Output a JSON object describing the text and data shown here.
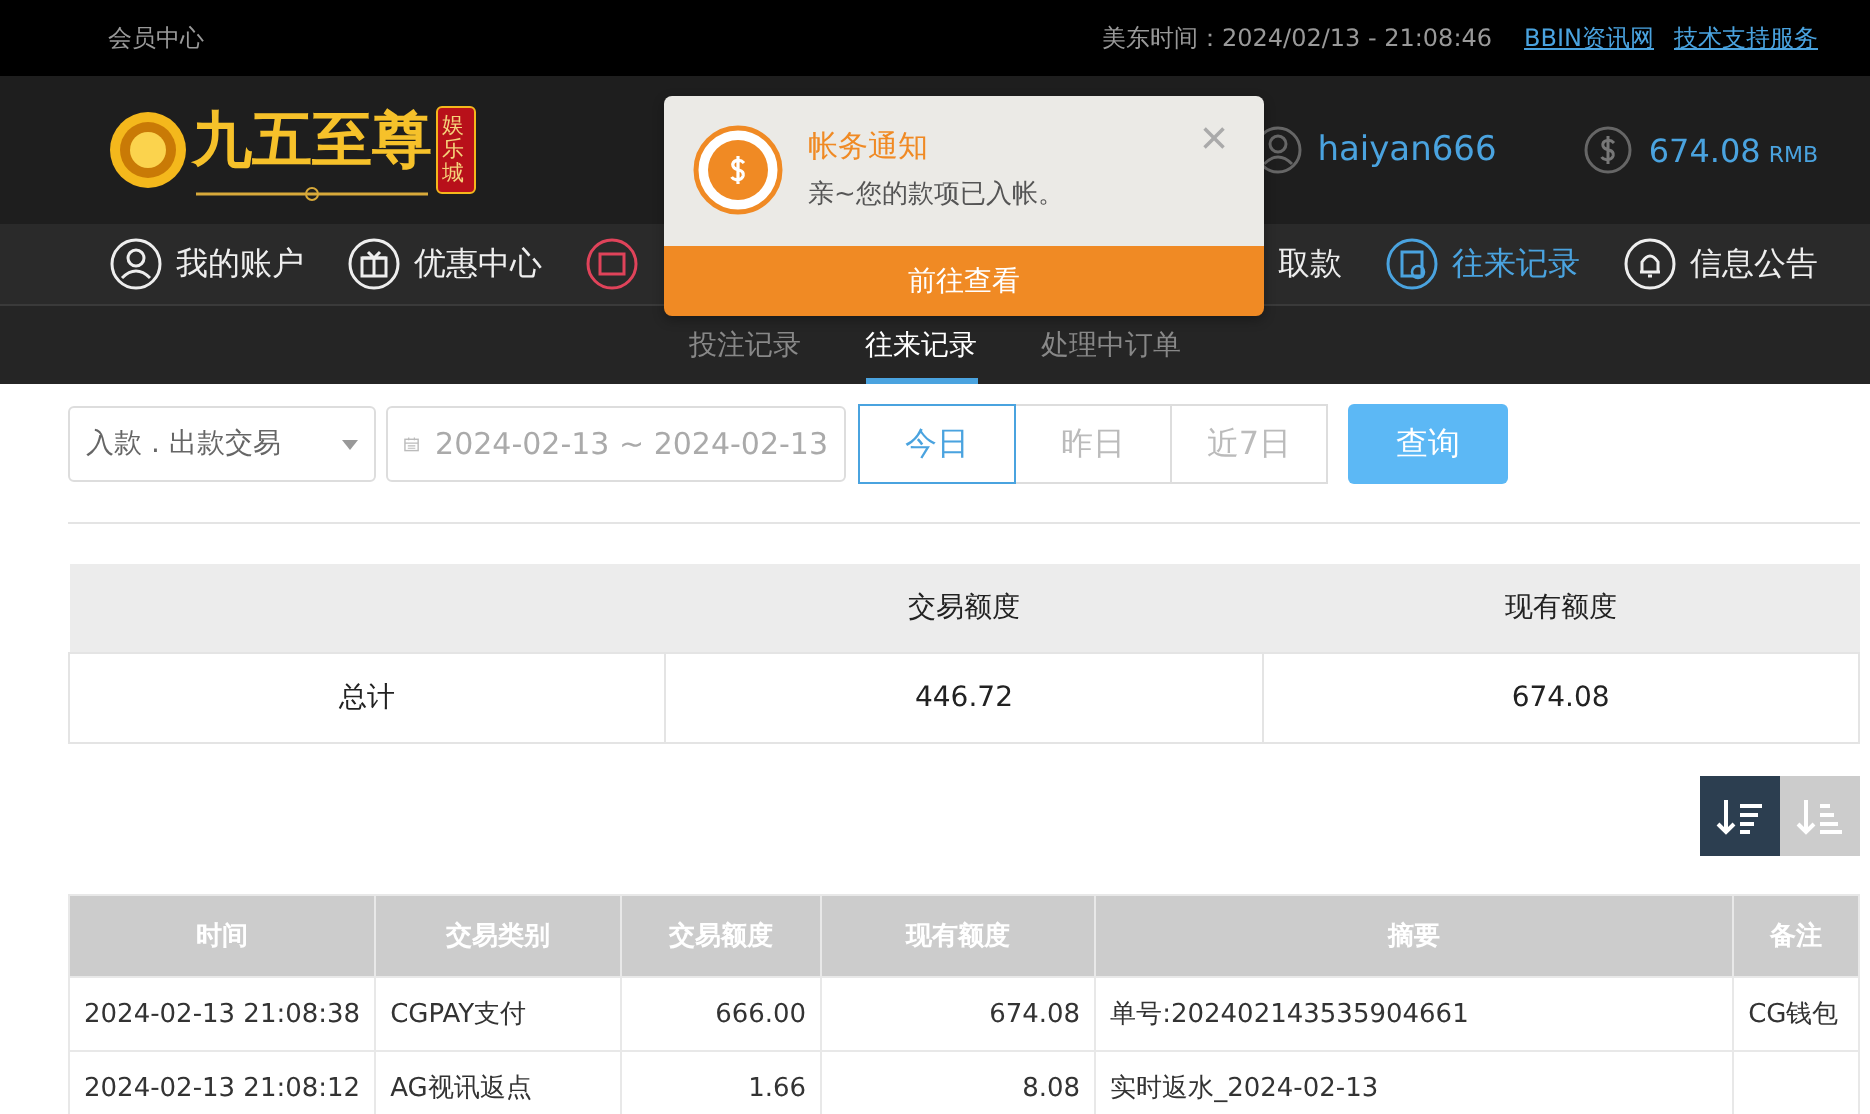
{
  "top_bar": {
    "title": "会员中心",
    "time_label": "美东时间：2024/02/13 - 21:08:46",
    "links": [
      "BBIN资讯网",
      "技术支持服务"
    ]
  },
  "header": {
    "logo_text": "九五至尊",
    "logo_badge": "娱乐城",
    "username": "haiyan666",
    "balance": "674.08",
    "currency": "RMB"
  },
  "nav": [
    {
      "label": "我的账户",
      "selected": false
    },
    {
      "label": "优惠中心",
      "selected": false
    },
    {
      "kind": "icon_only",
      "selected": false
    },
    {
      "kind": "label_only",
      "label": "取款",
      "selected": false
    },
    {
      "label": "往来记录",
      "selected": true
    },
    {
      "label": "信息公告",
      "selected": false
    }
  ],
  "subnav": [
    {
      "label": "投注记录",
      "selected": false
    },
    {
      "label": "往来记录",
      "selected": true
    },
    {
      "label": "处理中订单",
      "selected": false
    }
  ],
  "notification": {
    "title": "帐务通知",
    "message": "亲~您的款项已入帐。",
    "close": "×",
    "action": "前往查看"
  },
  "filters": {
    "type_select": "入款 . 出款交易",
    "date_range": "2024-02-13 ~ 2024-02-13",
    "quick_dates": [
      {
        "label": "今日",
        "selected": true
      },
      {
        "label": "昨日",
        "selected": false
      },
      {
        "label": "近7日",
        "selected": false
      }
    ],
    "query": "查询"
  },
  "summary": {
    "columns": [
      "",
      "交易额度",
      "现有额度"
    ],
    "rows": [
      [
        "总计",
        "446.72",
        "674.08"
      ]
    ]
  },
  "sort_buttons": [
    {
      "kind": "descending",
      "selected": true
    },
    {
      "kind": "ascending",
      "selected": false
    }
  ],
  "table": {
    "columns": [
      "时间",
      "交易类别",
      "交易额度",
      "现有额度",
      "摘要",
      "备注"
    ],
    "rows": [
      [
        "2024-02-13 21:08:38",
        "CGPAY支付",
        "666.00",
        "674.08",
        "单号:202402143535904661",
        "CG钱包"
      ],
      [
        "2024-02-13 21:08:12",
        "AG视讯返点",
        "1.66",
        "8.08",
        "实时返水_2024-02-13",
        ""
      ]
    ]
  }
}
